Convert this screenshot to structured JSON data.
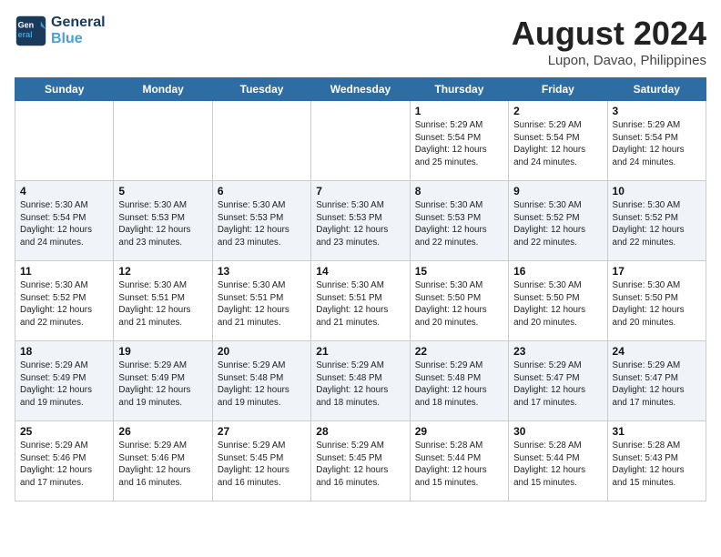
{
  "header": {
    "logo_line1": "General",
    "logo_line2": "Blue",
    "month_title": "August 2024",
    "location": "Lupon, Davao, Philippines"
  },
  "days_of_week": [
    "Sunday",
    "Monday",
    "Tuesday",
    "Wednesday",
    "Thursday",
    "Friday",
    "Saturday"
  ],
  "weeks": [
    [
      {
        "day": "",
        "info": ""
      },
      {
        "day": "",
        "info": ""
      },
      {
        "day": "",
        "info": ""
      },
      {
        "day": "",
        "info": ""
      },
      {
        "day": "1",
        "info": "Sunrise: 5:29 AM\nSunset: 5:54 PM\nDaylight: 12 hours\nand 25 minutes."
      },
      {
        "day": "2",
        "info": "Sunrise: 5:29 AM\nSunset: 5:54 PM\nDaylight: 12 hours\nand 24 minutes."
      },
      {
        "day": "3",
        "info": "Sunrise: 5:29 AM\nSunset: 5:54 PM\nDaylight: 12 hours\nand 24 minutes."
      }
    ],
    [
      {
        "day": "4",
        "info": "Sunrise: 5:30 AM\nSunset: 5:54 PM\nDaylight: 12 hours\nand 24 minutes."
      },
      {
        "day": "5",
        "info": "Sunrise: 5:30 AM\nSunset: 5:53 PM\nDaylight: 12 hours\nand 23 minutes."
      },
      {
        "day": "6",
        "info": "Sunrise: 5:30 AM\nSunset: 5:53 PM\nDaylight: 12 hours\nand 23 minutes."
      },
      {
        "day": "7",
        "info": "Sunrise: 5:30 AM\nSunset: 5:53 PM\nDaylight: 12 hours\nand 23 minutes."
      },
      {
        "day": "8",
        "info": "Sunrise: 5:30 AM\nSunset: 5:53 PM\nDaylight: 12 hours\nand 22 minutes."
      },
      {
        "day": "9",
        "info": "Sunrise: 5:30 AM\nSunset: 5:52 PM\nDaylight: 12 hours\nand 22 minutes."
      },
      {
        "day": "10",
        "info": "Sunrise: 5:30 AM\nSunset: 5:52 PM\nDaylight: 12 hours\nand 22 minutes."
      }
    ],
    [
      {
        "day": "11",
        "info": "Sunrise: 5:30 AM\nSunset: 5:52 PM\nDaylight: 12 hours\nand 22 minutes."
      },
      {
        "day": "12",
        "info": "Sunrise: 5:30 AM\nSunset: 5:51 PM\nDaylight: 12 hours\nand 21 minutes."
      },
      {
        "day": "13",
        "info": "Sunrise: 5:30 AM\nSunset: 5:51 PM\nDaylight: 12 hours\nand 21 minutes."
      },
      {
        "day": "14",
        "info": "Sunrise: 5:30 AM\nSunset: 5:51 PM\nDaylight: 12 hours\nand 21 minutes."
      },
      {
        "day": "15",
        "info": "Sunrise: 5:30 AM\nSunset: 5:50 PM\nDaylight: 12 hours\nand 20 minutes."
      },
      {
        "day": "16",
        "info": "Sunrise: 5:30 AM\nSunset: 5:50 PM\nDaylight: 12 hours\nand 20 minutes."
      },
      {
        "day": "17",
        "info": "Sunrise: 5:30 AM\nSunset: 5:50 PM\nDaylight: 12 hours\nand 20 minutes."
      }
    ],
    [
      {
        "day": "18",
        "info": "Sunrise: 5:29 AM\nSunset: 5:49 PM\nDaylight: 12 hours\nand 19 minutes."
      },
      {
        "day": "19",
        "info": "Sunrise: 5:29 AM\nSunset: 5:49 PM\nDaylight: 12 hours\nand 19 minutes."
      },
      {
        "day": "20",
        "info": "Sunrise: 5:29 AM\nSunset: 5:48 PM\nDaylight: 12 hours\nand 19 minutes."
      },
      {
        "day": "21",
        "info": "Sunrise: 5:29 AM\nSunset: 5:48 PM\nDaylight: 12 hours\nand 18 minutes."
      },
      {
        "day": "22",
        "info": "Sunrise: 5:29 AM\nSunset: 5:48 PM\nDaylight: 12 hours\nand 18 minutes."
      },
      {
        "day": "23",
        "info": "Sunrise: 5:29 AM\nSunset: 5:47 PM\nDaylight: 12 hours\nand 17 minutes."
      },
      {
        "day": "24",
        "info": "Sunrise: 5:29 AM\nSunset: 5:47 PM\nDaylight: 12 hours\nand 17 minutes."
      }
    ],
    [
      {
        "day": "25",
        "info": "Sunrise: 5:29 AM\nSunset: 5:46 PM\nDaylight: 12 hours\nand 17 minutes."
      },
      {
        "day": "26",
        "info": "Sunrise: 5:29 AM\nSunset: 5:46 PM\nDaylight: 12 hours\nand 16 minutes."
      },
      {
        "day": "27",
        "info": "Sunrise: 5:29 AM\nSunset: 5:45 PM\nDaylight: 12 hours\nand 16 minutes."
      },
      {
        "day": "28",
        "info": "Sunrise: 5:29 AM\nSunset: 5:45 PM\nDaylight: 12 hours\nand 16 minutes."
      },
      {
        "day": "29",
        "info": "Sunrise: 5:28 AM\nSunset: 5:44 PM\nDaylight: 12 hours\nand 15 minutes."
      },
      {
        "day": "30",
        "info": "Sunrise: 5:28 AM\nSunset: 5:44 PM\nDaylight: 12 hours\nand 15 minutes."
      },
      {
        "day": "31",
        "info": "Sunrise: 5:28 AM\nSunset: 5:43 PM\nDaylight: 12 hours\nand 15 minutes."
      }
    ]
  ]
}
